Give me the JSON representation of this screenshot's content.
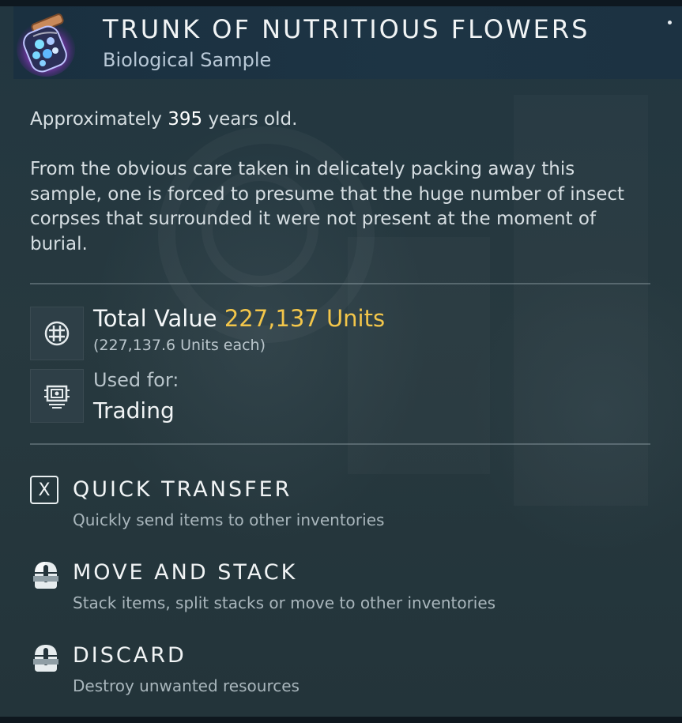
{
  "item": {
    "title": "TRUNK OF NUTRITIOUS FLOWERS",
    "subtitle": "Biological Sample",
    "icon": "flower-jar-icon"
  },
  "description": {
    "age_prefix": "Approximately ",
    "age_value": "395",
    "age_suffix": " years old.",
    "body": "From the obvious care taken in delicately packing away this sample, one is forced to presume that the huge number of insect corpses that surrounded it were not present at the moment of burial."
  },
  "value": {
    "label": "Total Value ",
    "amount": "227,137 Units",
    "each": "(227,137.6 Units each)",
    "icon": "units-currency-icon",
    "amount_color": "#f3c64a"
  },
  "usage": {
    "label": "Used for:",
    "value": "Trading",
    "icon": "trade-chip-icon"
  },
  "actions": [
    {
      "key": "X",
      "label": "QUICK TRANSFER",
      "description": "Quickly send items to other inventories",
      "icon": "x-key-icon"
    },
    {
      "label": "MOVE AND STACK",
      "description": "Stack items, split stacks or move to other inventories",
      "icon": "mouse-left-click-icon"
    },
    {
      "label": "DISCARD",
      "description": "Destroy unwanted resources",
      "icon": "mouse-hold-icon"
    }
  ]
}
